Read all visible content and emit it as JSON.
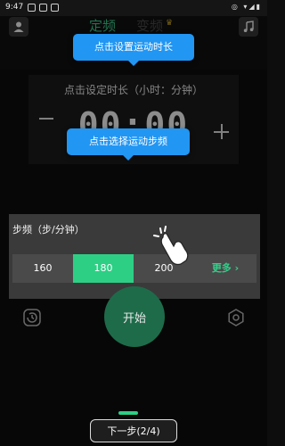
{
  "status_bar": {
    "time": "9:47"
  },
  "header": {
    "tab_fixed": "定频",
    "tab_variable": "变频",
    "crown": "♛"
  },
  "duration": {
    "label": "点击设定时长（小时：分钟）",
    "value": "00:00"
  },
  "tooltips": {
    "duration": "点击设置运动时长",
    "cadence": "点击选择运动步频"
  },
  "cadence": {
    "title": "步频（步/分钟）",
    "options": [
      "160",
      "180",
      "200"
    ],
    "selected": "180",
    "more_label": "更多 ›"
  },
  "controls": {
    "start_label": "开始"
  },
  "guide": {
    "next_label": "下一步(2/4)"
  },
  "colors": {
    "accent": "#2dcf85",
    "tooltip": "#2196f3",
    "background": "#0d0d0d"
  }
}
